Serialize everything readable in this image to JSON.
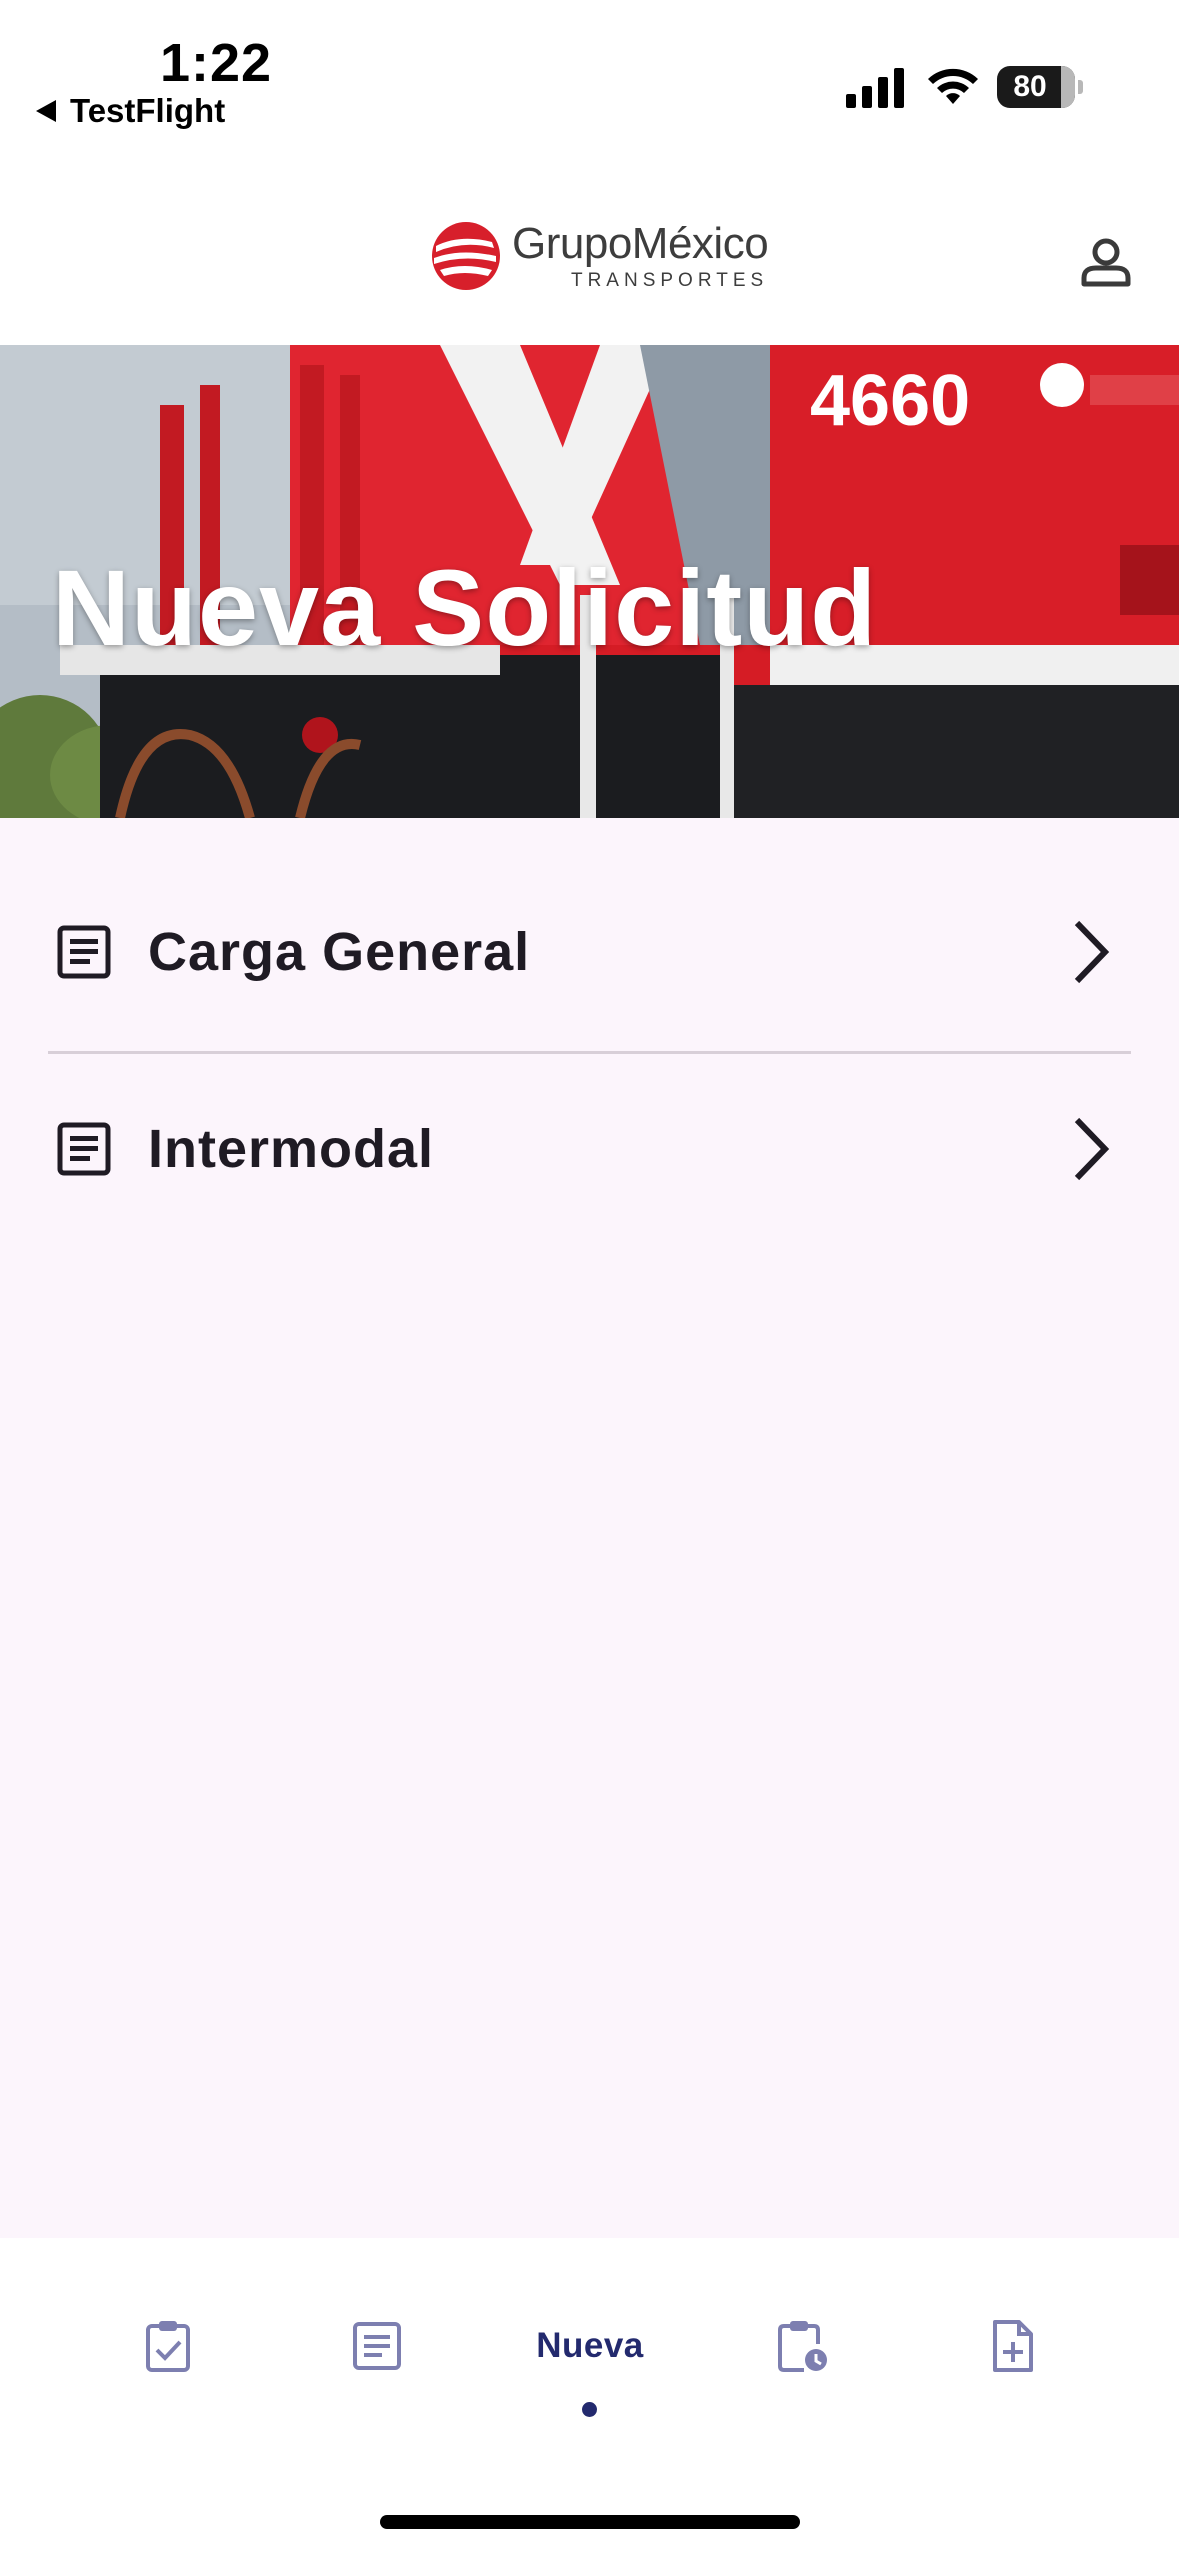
{
  "status_bar": {
    "time": "1:22",
    "back_app": "TestFlight",
    "battery": "80"
  },
  "header": {
    "logo_name": "GrupoMéxico",
    "logo_sub": "TRANSPORTES",
    "brand_color": "#d71f2b"
  },
  "hero": {
    "title": "Nueva Solicitud",
    "locomotive_number": "4660"
  },
  "list": {
    "items": [
      {
        "label": "Carga General",
        "icon": "document-icon"
      },
      {
        "label": "Intermodal",
        "icon": "document-icon"
      }
    ]
  },
  "bottom_nav": {
    "active_label": "Nueva",
    "active_color": "#232a6e",
    "inactive_color": "#7d7fb0",
    "items": [
      {
        "icon": "clipboard-check-icon"
      },
      {
        "icon": "document-list-icon"
      },
      {
        "icon": "new-request",
        "label": "Nueva"
      },
      {
        "icon": "clipboard-clock-icon"
      },
      {
        "icon": "file-add-icon"
      }
    ]
  }
}
